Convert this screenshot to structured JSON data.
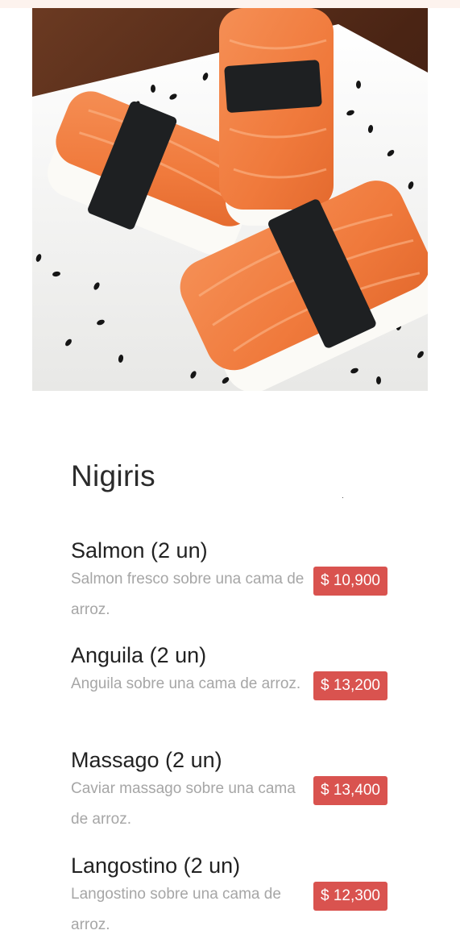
{
  "hero": {
    "image_alt": "Salmon nigiri sushi on a white plate with black sesame seeds",
    "colors": {
      "wood": "#5a2e1a",
      "plate": "#f3f3f1",
      "salmon": "#f07a3c",
      "nori": "#1e2022",
      "rice": "#fbfaf6"
    }
  },
  "section": {
    "title": "Nigiris"
  },
  "items": [
    {
      "name": "Salmon (2 un)",
      "description": "Salmon fresco sobre una cama de arroz.",
      "price": "$ 10,900"
    },
    {
      "name": "Anguila (2 un)",
      "description": "Anguila sobre una cama de arroz.",
      "price": "$ 13,200"
    },
    {
      "name": "Massago (2 un)",
      "description": "Caviar massago sobre una cama de arroz.",
      "price": "$ 13,400"
    },
    {
      "name": "Langostino (2 un)",
      "description": "Langostino sobre una cama de arroz.",
      "price": "$ 12,300"
    }
  ],
  "colors": {
    "price_badge": "#d9534f",
    "title_text": "#2b2b2b",
    "desc_text": "#a6a6a6"
  }
}
